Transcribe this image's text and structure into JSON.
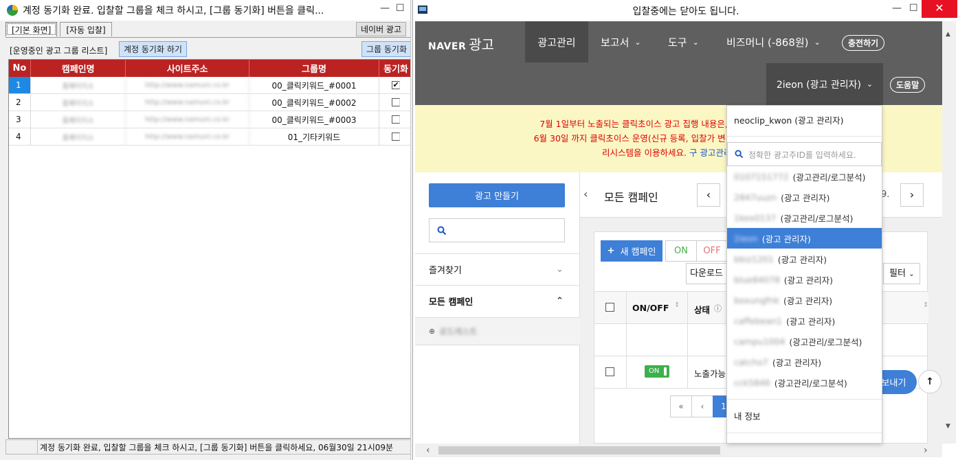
{
  "left": {
    "title": "계정 동기화 완료. 입찰할 그룹을 체크 하시고, [그룹 동기화] 버튼을 클릭...",
    "tabs": [
      "[기본 화면]",
      "[자동 입찰]"
    ],
    "naver_btn": "네이버 광고",
    "list_label": "[운영중인 광고 그룹 리스트]",
    "sync_account_btn": "계정 동기화 하기",
    "group_sync_btn": "그룹 동기화",
    "columns": [
      "No",
      "캠페인명",
      "사이트주소",
      "그룹명",
      "동기화"
    ],
    "rows": [
      {
        "no": "1",
        "camp": "홈페이지소",
        "site": "http://www.namuni.co.kr",
        "group": "00_클릭키워드_#0001",
        "checked": "✔"
      },
      {
        "no": "2",
        "camp": "홈페이지소",
        "site": "http://www.namuni.co.kr",
        "group": "00_클릭키워드_#0002",
        "checked": ""
      },
      {
        "no": "3",
        "camp": "홈페이지소",
        "site": "http://www.namuni.co.kr",
        "group": "00_클릭키워드_#0003",
        "checked": ""
      },
      {
        "no": "4",
        "camp": "홈페이지소",
        "site": "http://www.namuni.co.kr",
        "group": "01_기타키워드",
        "checked": ""
      }
    ],
    "status": "계정 동기화 완료, 입찰할 그룹을 체크 하시고, [그룹 동기화] 버튼을 클릭하세요, 06월30일 21시09분"
  },
  "right": {
    "title": "입찰중에는 닫아도 됩니다.",
    "logo_naver": "NAVER",
    "logo_ad": "광고",
    "nav": [
      "광고관리",
      "보고서",
      "도구",
      "비즈머니 (-868원)"
    ],
    "charge_btn": "충전하기",
    "user": "2ieon (광고 관리자)",
    "help_btn": "도움말",
    "notice_lines": [
      "7월 1일부터 노출되는 클릭초이스 광고 집행 내용은, 이곳 새 광고시스템에 업",
      "6월 30일 까지 클릭초이스 운영(신규 등록, 입찰가 변경, 문안 변경, 삭제, 재검수",
      "리시스템을 이용하세요."
    ],
    "notice_link": "구 광고관리시스템",
    "make_ad_btn": "광고 만들기",
    "favorites": "즐겨찾기",
    "all_campaigns": "모든 캠페인",
    "blurred_item": "로드레스트",
    "content_title": "모든 캠페인",
    "page_partial": "9.",
    "new_campaign": "새 캠페인",
    "on": "ON",
    "off": "OFF",
    "download": "다운로드",
    "filter": "필터",
    "col_onoff": "ON/OFF",
    "col_status": "상태",
    "row_toggle": "ON",
    "row_status": "노출가능",
    "page_num": "1",
    "dropdown": {
      "current": "neoclip_kwon  (광고 관리자)",
      "search_placeholder": "정확한 광고주ID를 입력하세요.",
      "items": [
        {
          "id": "0107151772",
          "role": "(광고관리/로그분석)"
        },
        {
          "id": "2847uuzn",
          "role": "(광고 관리자)"
        },
        {
          "id": "1kex0137",
          "role": "(광고관리/로그분석)"
        },
        {
          "id": "2ieon",
          "role": "(광고 관리자)"
        },
        {
          "id": "bbiz1201",
          "role": "(광고 관리자)"
        },
        {
          "id": "blue84078",
          "role": "(광고 관리자)"
        },
        {
          "id": "boxungfnk",
          "role": "(광고 관리자)"
        },
        {
          "id": "caffebean1",
          "role": "(광고 관리자)"
        },
        {
          "id": "campu1004",
          "role": "(광고관리/로그분석)"
        },
        {
          "id": "catcho7",
          "role": "(광고 관리자)"
        },
        {
          "id": "cck5846",
          "role": "(광고관리/로그분석)"
        }
      ],
      "my_info": "내 정보"
    },
    "feedback_btn": "의견 보내기"
  }
}
